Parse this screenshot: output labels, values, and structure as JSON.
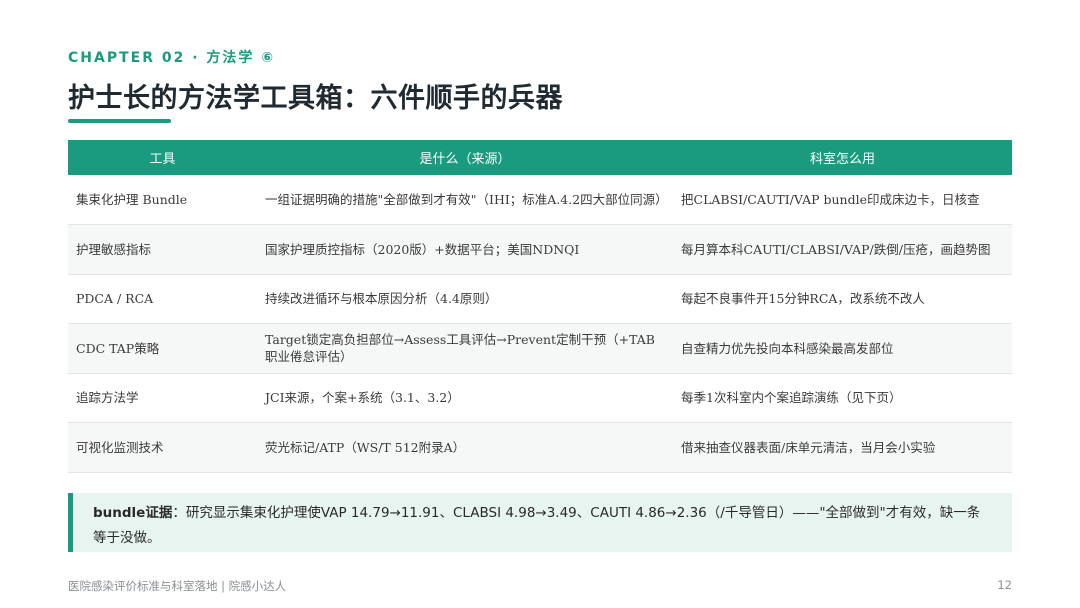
{
  "header": {
    "chapter": "CHAPTER 02 · 方法学 ⑥",
    "title": "护士长的方法学工具箱：六件顺手的兵器"
  },
  "table": {
    "columns": [
      "工具",
      "是什么（来源）",
      "科室怎么用"
    ],
    "rows": [
      [
        "集束化护理 Bundle",
        "一组证据明确的措施\"全部做到才有效\"（IHI；标准A.4.2四大部位同源）",
        "把CLABSI/CAUTI/VAP bundle印成床边卡，日核查"
      ],
      [
        "护理敏感指标",
        "国家护理质控指标（2020版）+数据平台；美国NDNQI",
        "每月算本科CAUTI/CLABSI/VAP/跌倒/压疮，画趋势图"
      ],
      [
        "PDCA / RCA",
        "持续改进循环与根本原因分析（4.4原则）",
        "每起不良事件开15分钟RCA，改系统不改人"
      ],
      [
        "CDC TAP策略",
        "Target锁定高负担部位→Assess工具评估→Prevent定制干预（+TAB职业倦怠评估）",
        "自查精力优先投向本科感染最高发部位"
      ],
      [
        "追踪方法学",
        "JCI来源，个案+系统（3.1、3.2）",
        "每季1次科室内个案追踪演练（见下页）"
      ],
      [
        "可视化监测技术",
        "荧光标记/ATP（WS/T 512附录A）",
        "借来抽查仪器表面/床单元清洁，当月会小实验"
      ]
    ]
  },
  "note": {
    "label": "bundle证据",
    "text": "：研究显示集束化护理使VAP 14.79→11.91、CLABSI 4.98→3.49、CAUTI 4.86→2.36（/千导管日）——\"全部做到\"才有效，缺一条等于没做。"
  },
  "footer": {
    "text": "医院感染评价标准与科室落地 | 院感小达人",
    "page": "12"
  },
  "colors": {
    "accent": "#1a9a7e",
    "note_bg": "#e8f4f0"
  }
}
